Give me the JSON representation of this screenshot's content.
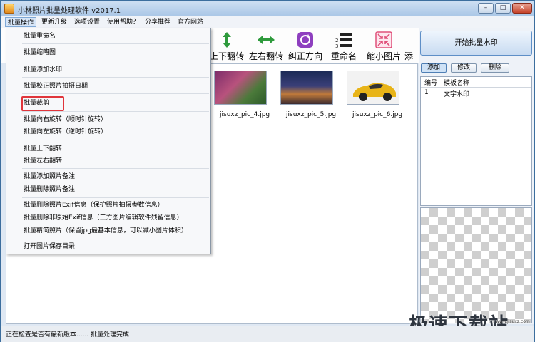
{
  "window": {
    "title": "小林照片批量处理软件 v2017.1",
    "controls": {
      "minimize": "–",
      "maximize": "□",
      "close": "✕"
    }
  },
  "menubar": {
    "items": [
      "批量操作",
      "更新升级",
      "选项设置",
      "使用帮助？",
      "分享推荐",
      "官方网站"
    ]
  },
  "toolbar": {
    "tools": [
      {
        "label": "上下翻转",
        "icon": "flip-vertical-icon",
        "color": "#2e9a3c"
      },
      {
        "label": "左右翻转",
        "icon": "flip-horizontal-icon",
        "color": "#2e9a3c"
      },
      {
        "label": "纠正方向",
        "icon": "rotate-icon",
        "color": "#8e3fbf"
      },
      {
        "label": "重命名",
        "icon": "numbered-list-icon",
        "color": "#222222"
      },
      {
        "label": "缩小图片",
        "icon": "shrink-icon",
        "color": "#e0507a"
      },
      {
        "label": "添",
        "icon": "",
        "color": "#000000"
      }
    ]
  },
  "thumbnails": [
    {
      "caption": "jisuxz_pic_4.jpg"
    },
    {
      "caption": "jisuxz_pic_5.jpg"
    },
    {
      "caption": "jisuxz_pic_6.jpg"
    }
  ],
  "right_panel": {
    "start_button": "开始批量水印",
    "buttons": [
      "添加",
      "修改",
      "删除"
    ],
    "columns": [
      "编号",
      "模板名称"
    ],
    "rows": [
      {
        "id": "1",
        "name": "文字水印"
      }
    ]
  },
  "dropdown": {
    "items": [
      "批量重命名",
      "批量缩略图",
      "批量添加水印",
      "批量校正照片拍摄日期",
      "批量裁剪",
      "批量向右旋转（顺时针旋转）",
      "批量向左旋转（逆时针旋转）",
      "批量上下翻转",
      "批量左右翻转",
      "批量添加照片备注",
      "批量删除照片备注",
      "批量删除照片Exif信息（保护照片拍摄参数信息）",
      "批量删除非原始Exif信息（三方图片编辑软件残留信息）",
      "批量精简照片（保留jpg最基本信息，可以减小图片体积）",
      "打开图片保存目录"
    ],
    "highlighted_item": "批量裁剪"
  },
  "status": {
    "left": "正在检查是否有最新版本......",
    "right": "批量处理完成"
  },
  "watermark": {
    "text": "极速下载站",
    "sub": "www.jisuxz.com"
  }
}
